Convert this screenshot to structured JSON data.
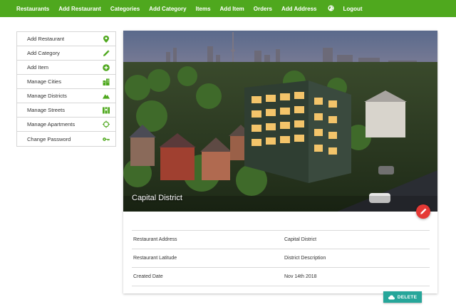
{
  "nav": {
    "items": [
      "Restaurants",
      "Add Restaurant",
      "Categories",
      "Add Category",
      "Items",
      "Add Item",
      "Orders",
      "Add Address"
    ],
    "globe_icon": "globe-icon",
    "logout": "Logout"
  },
  "sidebar": {
    "items": [
      {
        "label": "Add Restaurant",
        "icon": "map-pin-icon"
      },
      {
        "label": "Add Category",
        "icon": "pencil-icon"
      },
      {
        "label": "Add Item",
        "icon": "plus-circle-icon"
      },
      {
        "label": "Manage Cities",
        "icon": "buildings-icon"
      },
      {
        "label": "Manage Districts",
        "icon": "mountain-icon"
      },
      {
        "label": "Manage Streets",
        "icon": "map-icon"
      },
      {
        "label": "Manage Apartments",
        "icon": "crosshair-icon"
      },
      {
        "label": "Change Password",
        "icon": "key-icon"
      }
    ],
    "icon_color": "#4fa81e"
  },
  "card": {
    "hero_title": "Capital District",
    "rows": [
      {
        "label": "Restaurant Address",
        "value": "Capital District"
      },
      {
        "label": "Restaurant Latitude",
        "value": "District Description"
      },
      {
        "label": "Created Date",
        "value": "Nov 14th 2018"
      }
    ]
  },
  "actions": {
    "delete_label": "DELETE"
  },
  "colors": {
    "primary": "#4fa81e",
    "fab": "#e53935",
    "delete": "#26a69a"
  }
}
